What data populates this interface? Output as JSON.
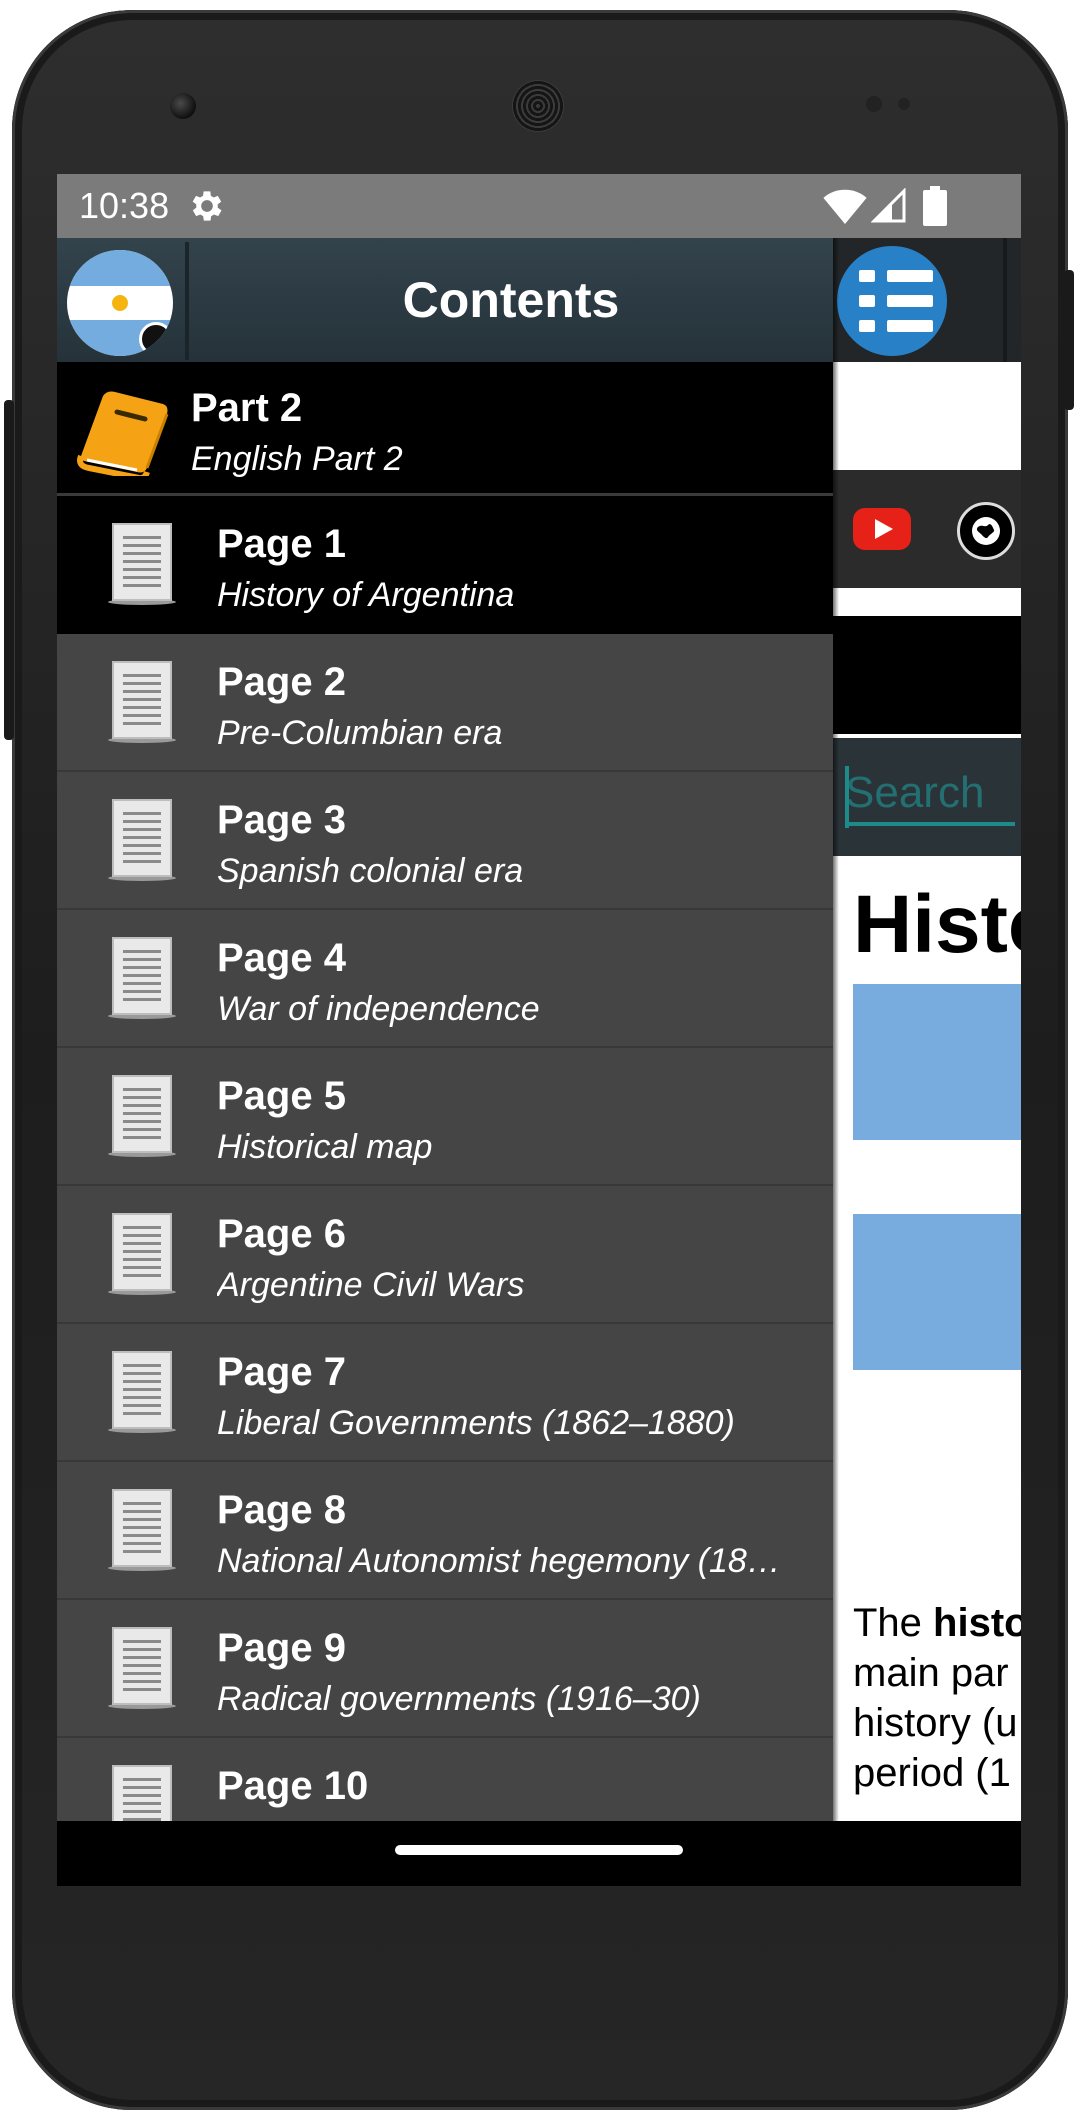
{
  "status_bar": {
    "time": "10:38",
    "icons": [
      "gear-icon",
      "wifi-icon",
      "signal-icon",
      "battery-icon"
    ]
  },
  "drawer": {
    "title": "Contents",
    "part": {
      "title": "Part 2",
      "subtitle": "English Part 2",
      "icon": "book-icon"
    },
    "pages": [
      {
        "title": "Page 1",
        "subtitle": "History of Argentina",
        "active": true
      },
      {
        "title": "Page 2",
        "subtitle": "Pre-Columbian era",
        "active": false
      },
      {
        "title": "Page 3",
        "subtitle": "Spanish colonial era",
        "active": false
      },
      {
        "title": "Page 4",
        "subtitle": "War of independence",
        "active": false
      },
      {
        "title": "Page 5",
        "subtitle": "Historical map",
        "active": false
      },
      {
        "title": "Page 6",
        "subtitle": "Argentine Civil Wars",
        "active": false
      },
      {
        "title": "Page 7",
        "subtitle": "Liberal Governments (1862–1880)",
        "active": false
      },
      {
        "title": "Page 8",
        "subtitle": "National Autonomist hegemony (18…",
        "active": false
      },
      {
        "title": "Page 9",
        "subtitle": "Radical governments (1916–30)",
        "active": false
      },
      {
        "title": "Page 10",
        "subtitle": "",
        "active": false
      }
    ]
  },
  "content": {
    "search_placeholder": "Search",
    "heading_partial": "Histo",
    "paragraph_lines": [
      {
        "text": "The ",
        "bold": "histo"
      },
      {
        "text": "main par",
        "bold": ""
      },
      {
        "text": "history (u",
        "bold": ""
      },
      {
        "text": "period (1",
        "bold": ""
      }
    ]
  },
  "colors": {
    "drawer_bg": "#454545",
    "active_row_bg": "#000000",
    "header_bg": "#2b3a42",
    "menu_button": "#2880c6",
    "book_icon": "#f5a314",
    "flag_blue": "#74acdf",
    "youtube_red": "#e62117"
  }
}
